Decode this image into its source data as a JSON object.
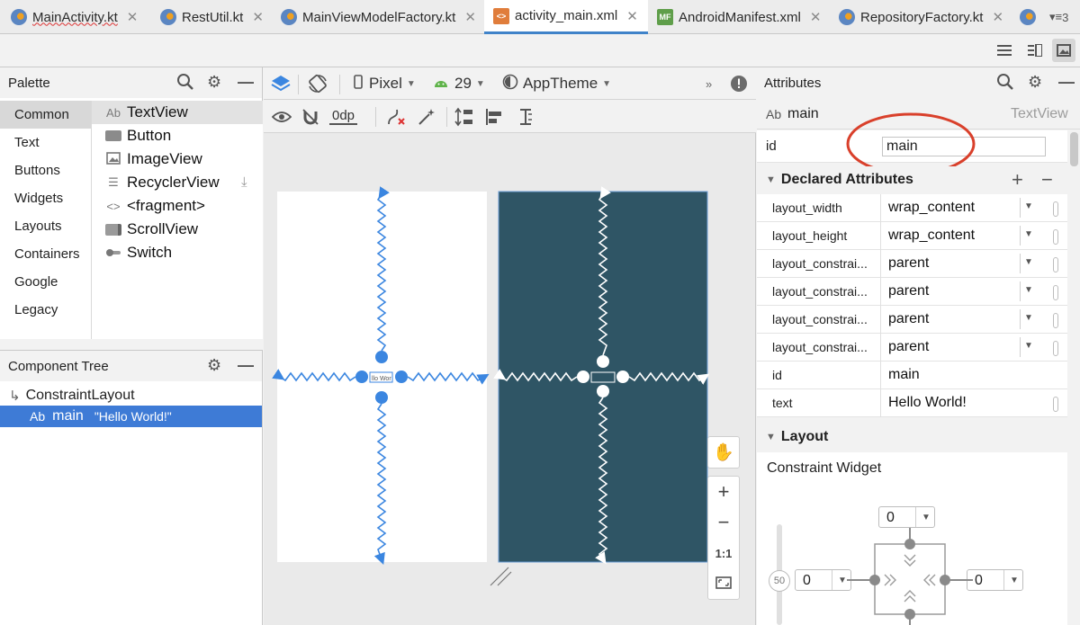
{
  "tabs": [
    {
      "label": "MainActivity.kt",
      "icon": "kotlin-file-icon",
      "error": true
    },
    {
      "label": "RestUtil.kt",
      "icon": "kotlin-file-icon",
      "error": false
    },
    {
      "label": "MainViewModelFactory.kt",
      "icon": "kotlin-file-icon",
      "error": false
    },
    {
      "label": "activity_main.xml",
      "icon": "xml-file-icon",
      "error": false,
      "active": true
    },
    {
      "label": "AndroidManifest.xml",
      "icon": "manifest-file-icon",
      "error": false
    },
    {
      "label": "RepositoryFactory.kt",
      "icon": "kotlin-file-icon",
      "error": false
    }
  ],
  "tab_overflow": "3",
  "palette": {
    "title": "Palette",
    "categories": [
      "Common",
      "Text",
      "Buttons",
      "Widgets",
      "Layouts",
      "Containers",
      "Google",
      "Legacy"
    ],
    "selected_category": "Common",
    "widgets": [
      {
        "label": "TextView",
        "icon_text": "Ab"
      },
      {
        "label": "Button",
        "icon_text": ""
      },
      {
        "label": "ImageView",
        "icon_text": ""
      },
      {
        "label": "RecyclerView",
        "icon_text": ""
      },
      {
        "label": "<fragment>",
        "icon_text": "<>"
      },
      {
        "label": "ScrollView",
        "icon_text": ""
      },
      {
        "label": "Switch",
        "icon_text": ""
      }
    ]
  },
  "component_tree": {
    "title": "Component Tree",
    "root": "ConstraintLayout",
    "child_badge": "Ab",
    "child_id": "main",
    "child_text": "\"Hello World!\""
  },
  "design_toolbar": {
    "device": "Pixel",
    "api": "29",
    "theme": "AppTheme",
    "margin": "0dp"
  },
  "canvas": {
    "blueprint_label": "llo Wor",
    "zoom_fit": "1:1"
  },
  "attributes": {
    "title": "Attributes",
    "component_badge": "Ab",
    "component_id": "main",
    "component_type": "TextView",
    "id_label": "id",
    "id_value": "main",
    "declared_title": "Declared Attributes",
    "declared": [
      {
        "key": "layout_width",
        "value": "wrap_content",
        "dropdown": true
      },
      {
        "key": "layout_height",
        "value": "wrap_content",
        "dropdown": true
      },
      {
        "key": "layout_constrai...",
        "value": "parent",
        "dropdown": true
      },
      {
        "key": "layout_constrai...",
        "value": "parent",
        "dropdown": true
      },
      {
        "key": "layout_constrai...",
        "value": "parent",
        "dropdown": true
      },
      {
        "key": "layout_constrai...",
        "value": "parent",
        "dropdown": true
      },
      {
        "key": "id",
        "value": "main",
        "dropdown": false,
        "pill": false
      },
      {
        "key": "text",
        "value": "Hello World!",
        "dropdown": false,
        "pill": true
      }
    ],
    "layout_title": "Layout",
    "constraint_widget_label": "Constraint Widget",
    "margin_top": "0",
    "margin_left": "0",
    "margin_right": "0",
    "bias": "50"
  },
  "colors": {
    "accent": "#4083c9",
    "selection": "#3e7bd6",
    "blueprint": "#2f5565",
    "constraint_blue": "#3b86e0",
    "highlight_ring": "#d9402b"
  }
}
